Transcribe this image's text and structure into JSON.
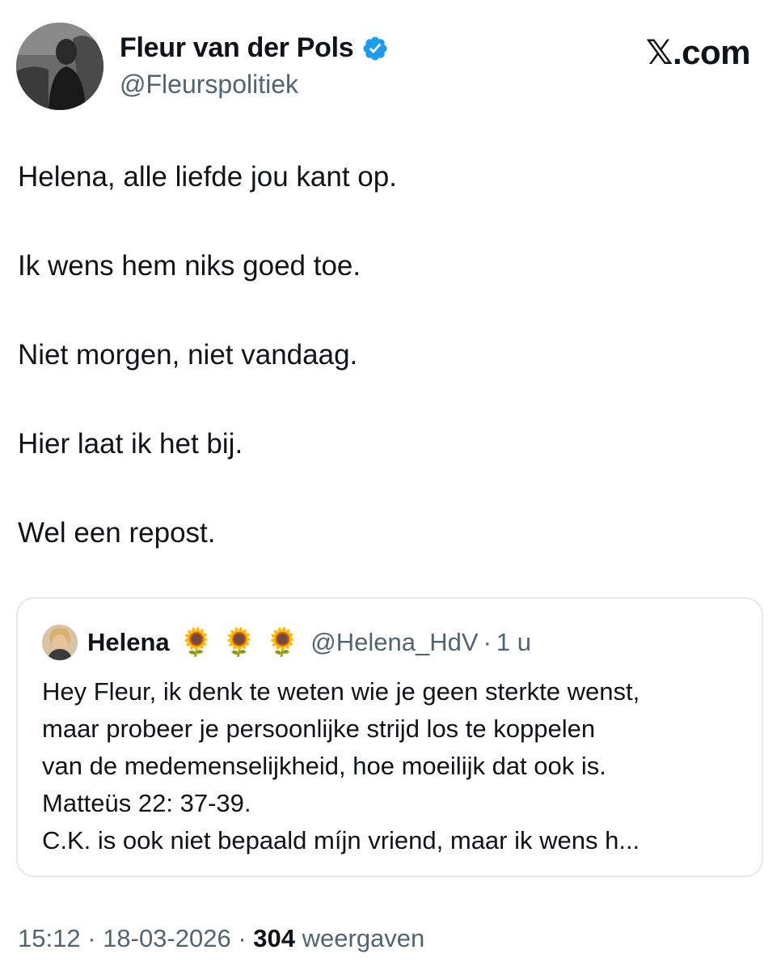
{
  "author": {
    "display_name": "Fleur van der Pols",
    "handle": "@Fleurspolitiek",
    "verified_icon": "verified-badge-icon",
    "avatar_icon": "profile-photo"
  },
  "brand": {
    "label": "𝕏.com"
  },
  "tweet": {
    "paragraphs": [
      "Helena, alle liefde jou kant op.",
      "Ik wens hem niks goed toe.",
      "Niet morgen, niet vandaag.",
      "Hier laat ik het bij.",
      "Wel een repost."
    ]
  },
  "quoted": {
    "display_name": "Helena",
    "emojis": "🌻 🌻 🌻",
    "handle": "@Helena_HdV",
    "separator": "·",
    "time": "1 u",
    "lines": [
      "Hey Fleur, ik denk te weten wie je geen sterkte wenst,",
      "maar probeer je persoonlijke strijd los te koppelen",
      "van de medemenselijkheid, hoe moeilijk dat ook is.",
      "Matteüs 22: 37-39.",
      "C.K. is ook niet bepaald míjn vriend, maar ik wens h..."
    ]
  },
  "meta": {
    "time": "15:12",
    "sep1": " · ",
    "date": "18-03-2026",
    "sep2": " · ",
    "views_count": "304",
    "views_label": " weergaven"
  },
  "colors": {
    "text": "#0f1419",
    "muted": "#536471",
    "verified": "#1d9bf0",
    "border": "#e6e9ec",
    "sunflower": "#f2b705"
  }
}
